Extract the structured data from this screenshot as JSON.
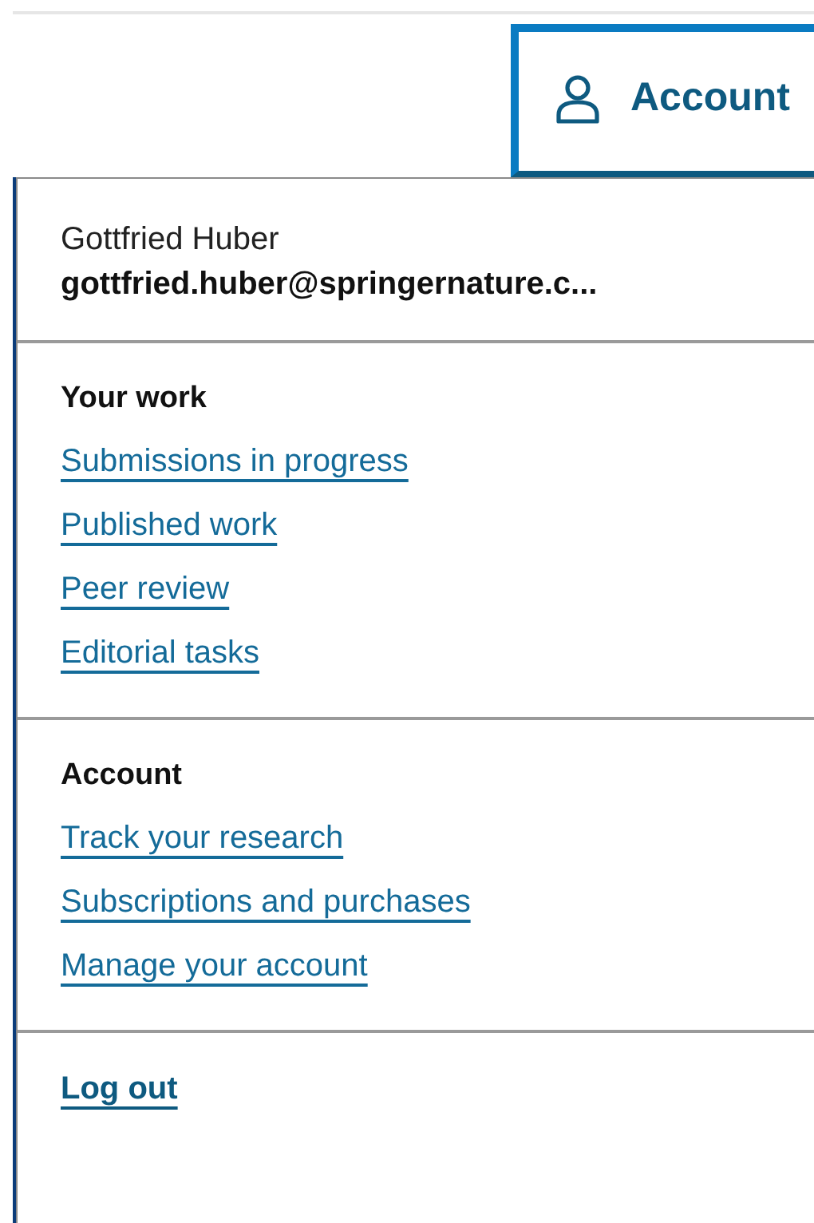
{
  "account_button": {
    "label": "Account",
    "expanded": true
  },
  "user": {
    "name": "Gottfried Huber",
    "email": "gottfried.huber@springernature.c..."
  },
  "sections": [
    {
      "heading": "Your work",
      "links": [
        "Submissions in progress",
        "Published work",
        "Peer review",
        "Editorial tasks"
      ]
    },
    {
      "heading": "Account",
      "links": [
        "Track your research",
        "Subscriptions and purchases",
        "Manage your account"
      ]
    }
  ],
  "logout": "Log out"
}
